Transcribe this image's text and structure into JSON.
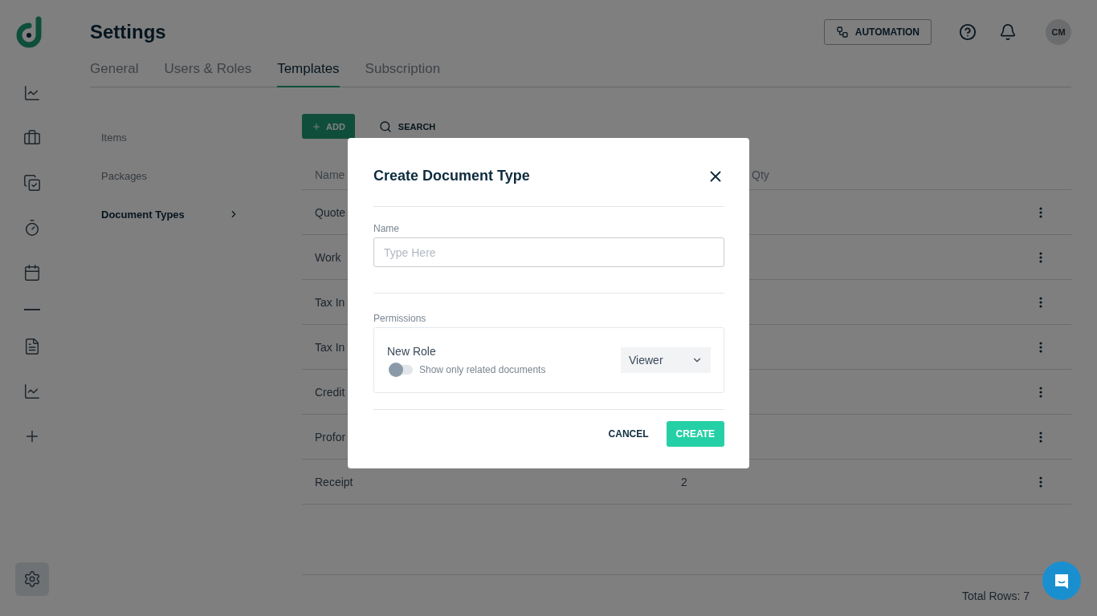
{
  "sidebar": {
    "items": [
      {
        "kind": "chart"
      },
      {
        "kind": "briefcase"
      },
      {
        "kind": "tasks"
      },
      {
        "kind": "timer"
      },
      {
        "kind": "calendar"
      },
      {
        "kind": "divider"
      },
      {
        "kind": "document"
      },
      {
        "kind": "chart"
      },
      {
        "kind": "add"
      }
    ],
    "settings": {
      "selected": true
    }
  },
  "header": {
    "title": "Settings",
    "automation": "AUTOMATION",
    "avatar": "CM"
  },
  "tabs": [
    {
      "label": "General",
      "selected": false
    },
    {
      "label": "Users & Roles",
      "selected": false
    },
    {
      "label": "Templates",
      "selected": true
    },
    {
      "label": "Subscription",
      "selected": false
    }
  ],
  "subnav": [
    {
      "label": "Items",
      "selected": false
    },
    {
      "label": "Packages",
      "selected": false
    },
    {
      "label": "Document Types",
      "selected": true
    }
  ],
  "toolbar": {
    "add": "ADD",
    "search": "SEARCH"
  },
  "table": {
    "columns": [
      "Name",
      "Qty"
    ],
    "rows": [
      {
        "name": "Quote"
      },
      {
        "name": "Work"
      },
      {
        "name": "Tax In"
      },
      {
        "name": "Tax In"
      },
      {
        "name": "Credit"
      },
      {
        "name": "Profor"
      },
      {
        "name": "Receipt",
        "qty": "2"
      }
    ],
    "total": "Total Rows: 7"
  },
  "modal": {
    "title": "Create Document Type",
    "name_label": "Name",
    "placeholder": "Type Here",
    "permissions_label": "Permissions",
    "role": {
      "name": "New Role",
      "toggle_label": "Show only related documents",
      "on": false,
      "access": "Viewer"
    },
    "cancel": "CANCEL",
    "create": "CREATE"
  }
}
